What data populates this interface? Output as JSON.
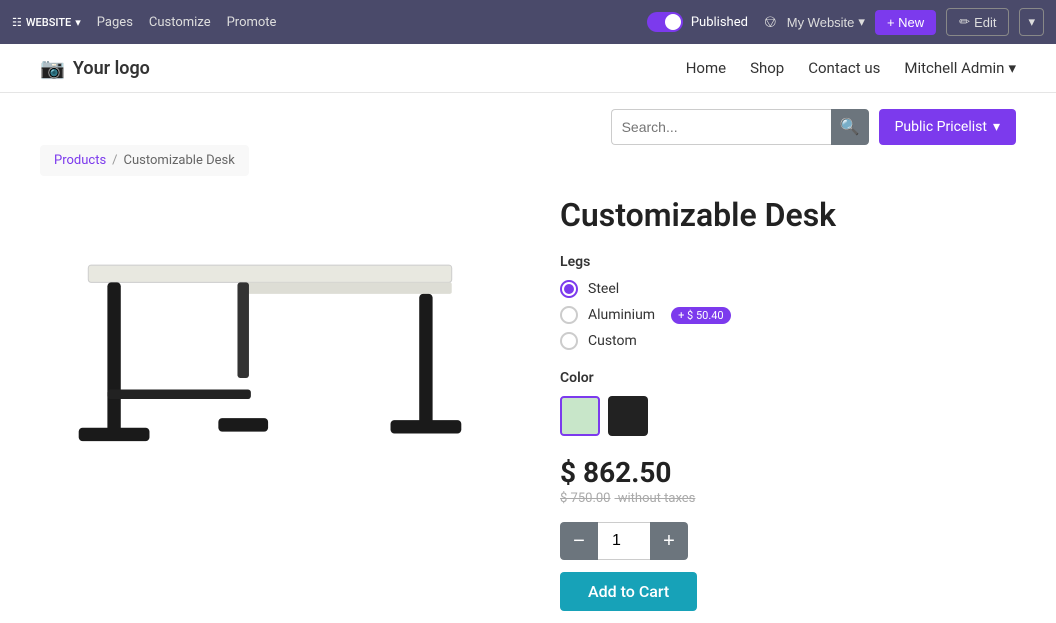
{
  "topbar": {
    "website_label": "WEBSITE",
    "pages_label": "Pages",
    "customize_label": "Customize",
    "promote_label": "Promote",
    "published_label": "Published",
    "my_website_label": "My Website",
    "new_label": "+ New",
    "edit_label": "Edit",
    "more_label": "▾"
  },
  "site_header": {
    "logo_text": "Your logo",
    "nav_items": [
      {
        "label": "Home",
        "id": "home"
      },
      {
        "label": "Shop",
        "id": "shop"
      },
      {
        "label": "Contact us",
        "id": "contact"
      },
      {
        "label": "Mitchell Admin",
        "id": "admin"
      }
    ]
  },
  "search": {
    "placeholder": "Search...",
    "pricelist_label": "Public Pricelist"
  },
  "breadcrumb": {
    "parent_label": "Products",
    "current_label": "Customizable Desk",
    "separator": "/"
  },
  "product": {
    "title": "Customizable Desk",
    "legs_label": "Legs",
    "legs_options": [
      {
        "id": "steel",
        "label": "Steel",
        "selected": true,
        "badge": null
      },
      {
        "id": "aluminium",
        "label": "Aluminium",
        "selected": false,
        "badge": "+ $ 50.40"
      },
      {
        "id": "custom",
        "label": "Custom",
        "selected": false,
        "badge": null
      }
    ],
    "color_label": "Color",
    "colors": [
      {
        "id": "green",
        "hex": "#c8e6c9",
        "selected": true
      },
      {
        "id": "black",
        "hex": "#222222",
        "selected": false
      }
    ],
    "price_main": "$ 862.50",
    "price_excl_label": "$ 750.00 without taxes",
    "price_excl_value": "$ 750.00",
    "price_excl_suffix": " without taxes",
    "quantity": "1",
    "add_to_cart_label": "Add to Cart"
  }
}
